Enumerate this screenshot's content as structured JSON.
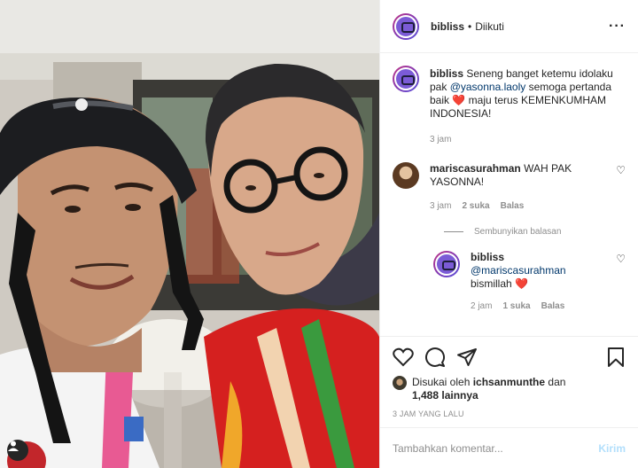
{
  "post": {
    "username": "bibliss",
    "follow_status": "Diikuti",
    "more_icon": "more-horizontal-icon"
  },
  "caption": {
    "username": "bibliss",
    "text_before": "Seneng banget ketemu idolaku pak",
    "mention": "@yasonna.laoly",
    "text_mid": "semoga pertanda baik",
    "text_after": "maju terus KEMENKUMHAM INDONESIA!",
    "time": "3 jam"
  },
  "comments": [
    {
      "username": "mariscasurahman",
      "text": "WAH PAK YASONNA!",
      "time": "3 jam",
      "likes": "2 suka",
      "reply_label": "Balas"
    }
  ],
  "replies_toggle": "Sembunyikan balasan",
  "reply": {
    "username": "bibliss",
    "mention": "@mariscasurahman",
    "text": "bismillah",
    "time": "2 jam",
    "likes": "1 suka",
    "reply_label": "Balas"
  },
  "likes": {
    "prefix": "Disukai oleh",
    "user": "ichsanmunthe",
    "and": "dan",
    "count": "1,488 lainnya"
  },
  "timestamp": "3 JAM YANG LALU",
  "composer": {
    "placeholder": "Tambahkan komentar...",
    "send": "Kirim"
  },
  "colors": {
    "accent": "#0095f6",
    "send_disabled": "#b2dffc",
    "heart": "#ed4956",
    "mention": "#00376b"
  }
}
